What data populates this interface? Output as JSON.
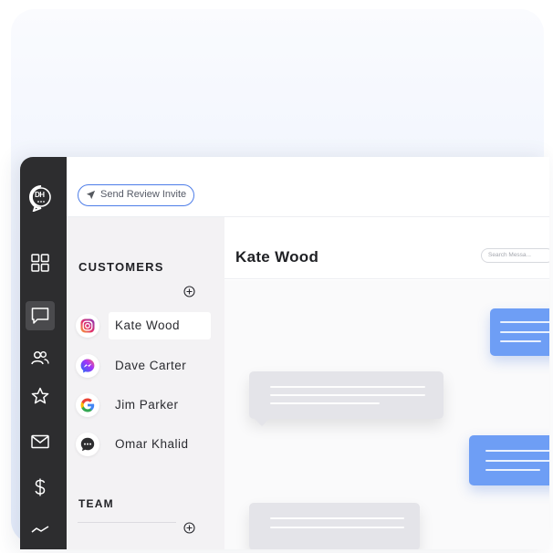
{
  "app": {
    "logo_text": "DH",
    "send_invite_label": "Send Review Invite"
  },
  "rail": {
    "icons": [
      "dashboard-icon",
      "chat-icon",
      "users-icon",
      "star-icon",
      "mail-icon",
      "dollar-icon",
      "analytics-icon"
    ],
    "active": "chat-icon"
  },
  "sidebar": {
    "customers_title": "CUSTOMERS",
    "team_title": "TEAM",
    "customers": [
      {
        "name": "Kate Wood",
        "source": "instagram-icon",
        "selected": true
      },
      {
        "name": "Dave Carter",
        "source": "messenger-icon",
        "selected": false
      },
      {
        "name": "Jim Parker",
        "source": "google-icon",
        "selected": false
      },
      {
        "name": "Omar Khalid",
        "source": "sms-icon",
        "selected": false
      }
    ]
  },
  "chat": {
    "title": "Kate Wood",
    "search_placeholder": "Search Messa..."
  },
  "colors": {
    "rail": "#2d2d2f",
    "accent": "#4d7de8",
    "outgoing_bubble": "#6e9ef5",
    "incoming_bubble": "#e4e4e9"
  }
}
